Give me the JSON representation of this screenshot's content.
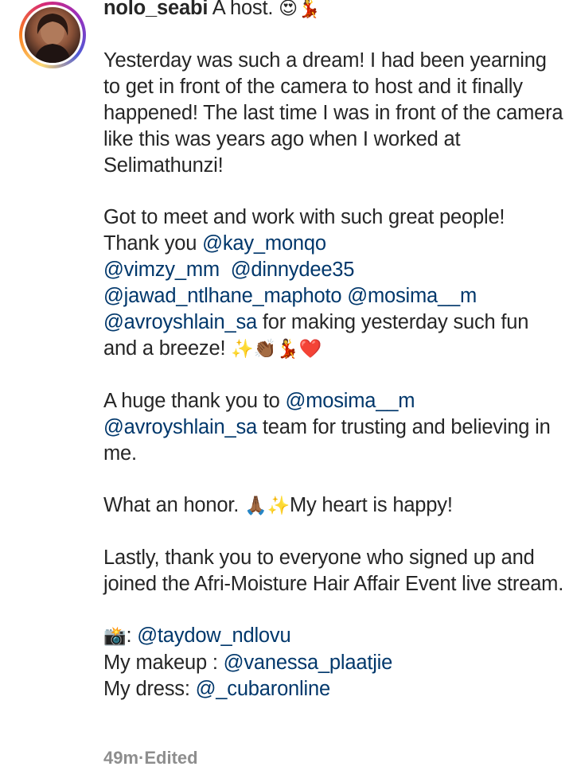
{
  "post": {
    "username": "nolo_seabi",
    "headline": "A host. ",
    "headline_emojis": [
      "😍",
      "💃"
    ],
    "paragraph1": "Yesterday was such a dream! I had been yearning to get in front of the camera to host and it finally happened! The last time I was in front of the camera like this was years ago when I worked at Selimathunzi!",
    "paragraph2": {
      "intro": "Got to meet and work with such great people! Thank you ",
      "mentions": [
        "@kay_monqo",
        "@vimzy_mm",
        "@dinnydee35",
        "@jawad_ntlhane_maphoto",
        "@mosima__m",
        "@avroyshlain_sa"
      ],
      "outro": " for making yesterday such fun and a breeze! ",
      "emojis": [
        "✨",
        "👏🏾",
        "💃",
        "❤️"
      ]
    },
    "paragraph3": {
      "intro": "A huge thank you to ",
      "mentions": [
        "@mosima__m",
        "@avroyshlain_sa"
      ],
      "outro": " team for trusting and believing in me."
    },
    "paragraph4": {
      "text1": "What an honor. ",
      "emojis": [
        "🙏🏾",
        "✨"
      ],
      "text2": "My heart is happy!"
    },
    "paragraph5": "Lastly, thank you to everyone who signed up and joined the Afri-Moisture Hair Affair Event live stream.",
    "credits": {
      "camera_emoji": "📸",
      "photo_sep": ": ",
      "photo_mention": "@taydow_ndlovu",
      "makeup_label": "My makeup : ",
      "makeup_mention": "@vanessa_plaatjie",
      "dress_label": "My dress: ",
      "dress_mention": "@_cubaronline"
    },
    "time_ago": "49m",
    "separator": " · ",
    "edited_label": "Edited"
  },
  "colors": {
    "text": "#262626",
    "mention": "#00376b",
    "meta": "#8e8e8e"
  }
}
